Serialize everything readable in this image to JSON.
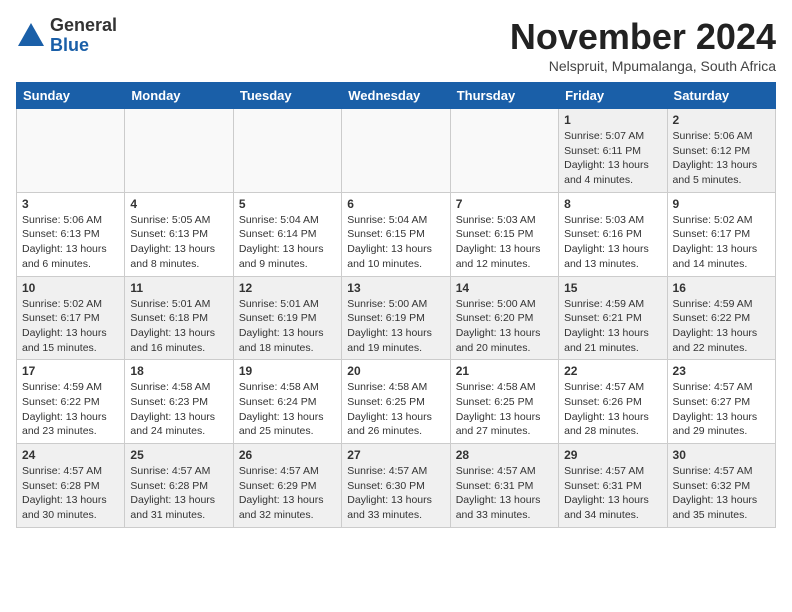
{
  "header": {
    "logo_general": "General",
    "logo_blue": "Blue",
    "month_title": "November 2024",
    "subtitle": "Nelspruit, Mpumalanga, South Africa"
  },
  "weekdays": [
    "Sunday",
    "Monday",
    "Tuesday",
    "Wednesday",
    "Thursday",
    "Friday",
    "Saturday"
  ],
  "weeks": [
    [
      {
        "day": "",
        "info": "",
        "empty": true
      },
      {
        "day": "",
        "info": "",
        "empty": true
      },
      {
        "day": "",
        "info": "",
        "empty": true
      },
      {
        "day": "",
        "info": "",
        "empty": true
      },
      {
        "day": "",
        "info": "",
        "empty": true
      },
      {
        "day": "1",
        "info": "Sunrise: 5:07 AM\nSunset: 6:11 PM\nDaylight: 13 hours\nand 4 minutes.",
        "empty": false
      },
      {
        "day": "2",
        "info": "Sunrise: 5:06 AM\nSunset: 6:12 PM\nDaylight: 13 hours\nand 5 minutes.",
        "empty": false
      }
    ],
    [
      {
        "day": "3",
        "info": "Sunrise: 5:06 AM\nSunset: 6:13 PM\nDaylight: 13 hours\nand 6 minutes.",
        "empty": false
      },
      {
        "day": "4",
        "info": "Sunrise: 5:05 AM\nSunset: 6:13 PM\nDaylight: 13 hours\nand 8 minutes.",
        "empty": false
      },
      {
        "day": "5",
        "info": "Sunrise: 5:04 AM\nSunset: 6:14 PM\nDaylight: 13 hours\nand 9 minutes.",
        "empty": false
      },
      {
        "day": "6",
        "info": "Sunrise: 5:04 AM\nSunset: 6:15 PM\nDaylight: 13 hours\nand 10 minutes.",
        "empty": false
      },
      {
        "day": "7",
        "info": "Sunrise: 5:03 AM\nSunset: 6:15 PM\nDaylight: 13 hours\nand 12 minutes.",
        "empty": false
      },
      {
        "day": "8",
        "info": "Sunrise: 5:03 AM\nSunset: 6:16 PM\nDaylight: 13 hours\nand 13 minutes.",
        "empty": false
      },
      {
        "day": "9",
        "info": "Sunrise: 5:02 AM\nSunset: 6:17 PM\nDaylight: 13 hours\nand 14 minutes.",
        "empty": false
      }
    ],
    [
      {
        "day": "10",
        "info": "Sunrise: 5:02 AM\nSunset: 6:17 PM\nDaylight: 13 hours\nand 15 minutes.",
        "empty": false
      },
      {
        "day": "11",
        "info": "Sunrise: 5:01 AM\nSunset: 6:18 PM\nDaylight: 13 hours\nand 16 minutes.",
        "empty": false
      },
      {
        "day": "12",
        "info": "Sunrise: 5:01 AM\nSunset: 6:19 PM\nDaylight: 13 hours\nand 18 minutes.",
        "empty": false
      },
      {
        "day": "13",
        "info": "Sunrise: 5:00 AM\nSunset: 6:19 PM\nDaylight: 13 hours\nand 19 minutes.",
        "empty": false
      },
      {
        "day": "14",
        "info": "Sunrise: 5:00 AM\nSunset: 6:20 PM\nDaylight: 13 hours\nand 20 minutes.",
        "empty": false
      },
      {
        "day": "15",
        "info": "Sunrise: 4:59 AM\nSunset: 6:21 PM\nDaylight: 13 hours\nand 21 minutes.",
        "empty": false
      },
      {
        "day": "16",
        "info": "Sunrise: 4:59 AM\nSunset: 6:22 PM\nDaylight: 13 hours\nand 22 minutes.",
        "empty": false
      }
    ],
    [
      {
        "day": "17",
        "info": "Sunrise: 4:59 AM\nSunset: 6:22 PM\nDaylight: 13 hours\nand 23 minutes.",
        "empty": false
      },
      {
        "day": "18",
        "info": "Sunrise: 4:58 AM\nSunset: 6:23 PM\nDaylight: 13 hours\nand 24 minutes.",
        "empty": false
      },
      {
        "day": "19",
        "info": "Sunrise: 4:58 AM\nSunset: 6:24 PM\nDaylight: 13 hours\nand 25 minutes.",
        "empty": false
      },
      {
        "day": "20",
        "info": "Sunrise: 4:58 AM\nSunset: 6:25 PM\nDaylight: 13 hours\nand 26 minutes.",
        "empty": false
      },
      {
        "day": "21",
        "info": "Sunrise: 4:58 AM\nSunset: 6:25 PM\nDaylight: 13 hours\nand 27 minutes.",
        "empty": false
      },
      {
        "day": "22",
        "info": "Sunrise: 4:57 AM\nSunset: 6:26 PM\nDaylight: 13 hours\nand 28 minutes.",
        "empty": false
      },
      {
        "day": "23",
        "info": "Sunrise: 4:57 AM\nSunset: 6:27 PM\nDaylight: 13 hours\nand 29 minutes.",
        "empty": false
      }
    ],
    [
      {
        "day": "24",
        "info": "Sunrise: 4:57 AM\nSunset: 6:28 PM\nDaylight: 13 hours\nand 30 minutes.",
        "empty": false
      },
      {
        "day": "25",
        "info": "Sunrise: 4:57 AM\nSunset: 6:28 PM\nDaylight: 13 hours\nand 31 minutes.",
        "empty": false
      },
      {
        "day": "26",
        "info": "Sunrise: 4:57 AM\nSunset: 6:29 PM\nDaylight: 13 hours\nand 32 minutes.",
        "empty": false
      },
      {
        "day": "27",
        "info": "Sunrise: 4:57 AM\nSunset: 6:30 PM\nDaylight: 13 hours\nand 33 minutes.",
        "empty": false
      },
      {
        "day": "28",
        "info": "Sunrise: 4:57 AM\nSunset: 6:31 PM\nDaylight: 13 hours\nand 33 minutes.",
        "empty": false
      },
      {
        "day": "29",
        "info": "Sunrise: 4:57 AM\nSunset: 6:31 PM\nDaylight: 13 hours\nand 34 minutes.",
        "empty": false
      },
      {
        "day": "30",
        "info": "Sunrise: 4:57 AM\nSunset: 6:32 PM\nDaylight: 13 hours\nand 35 minutes.",
        "empty": false
      }
    ]
  ]
}
